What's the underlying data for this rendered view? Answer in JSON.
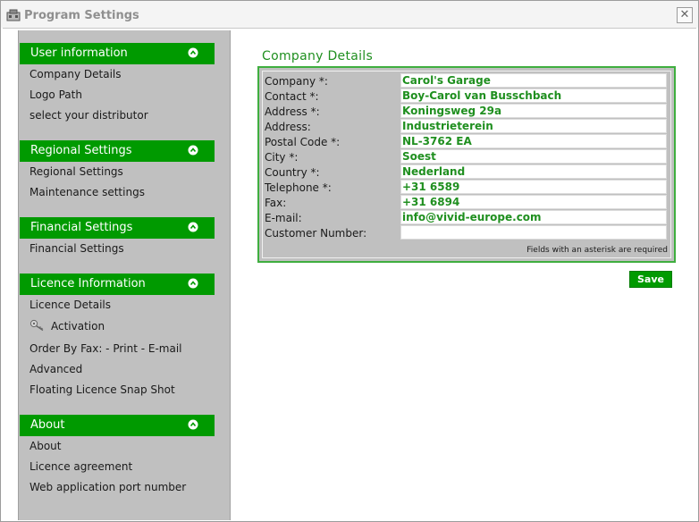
{
  "window": {
    "title": "Program Settings",
    "close_glyph": "✕"
  },
  "sidebar": {
    "sections": [
      {
        "header": "User information",
        "items": [
          "Company Details",
          "Logo Path",
          "select your distributor"
        ]
      },
      {
        "header": "Regional Settings",
        "items": [
          "Regional Settings",
          "Maintenance settings"
        ]
      },
      {
        "header": "Financial Settings",
        "items": [
          "Financial Settings"
        ]
      },
      {
        "header": "Licence Information",
        "items": [
          "Licence Details",
          "Activation",
          "Order By Fax: - Print - E-mail",
          "Advanced",
          "Floating Licence Snap Shot"
        ]
      },
      {
        "header": "About",
        "items": [
          "About",
          "Licence agreement",
          "Web application port number"
        ]
      }
    ]
  },
  "content": {
    "title": "Company Details",
    "fields": [
      {
        "label": "Company *:",
        "value": "Carol's Garage"
      },
      {
        "label": "Contact *:",
        "value": "Boy-Carol van Busschbach"
      },
      {
        "label": "Address *:",
        "value": "Koningsweg 29a"
      },
      {
        "label": "Address:",
        "value": "Industrieterein"
      },
      {
        "label": "Postal Code *:",
        "value": "NL-3762 EA"
      },
      {
        "label": "City *:",
        "value": "Soest"
      },
      {
        "label": "Country *:",
        "value": "Nederland"
      },
      {
        "label": "Telephone *:",
        "value": "+31 6589"
      },
      {
        "label": "Fax:",
        "value": "+31 6894"
      },
      {
        "label": "E-mail:",
        "value": "info@vivid-europe.com"
      },
      {
        "label": "Customer Number:",
        "value": ""
      }
    ],
    "note": "Fields with an asterisk are required",
    "save_label": "Save"
  },
  "colors": {
    "accent_green": "#009a00",
    "text_green": "#1f8f1f",
    "panel_gray": "#c0c0c0"
  },
  "icons": {
    "app": "program-settings-icon",
    "section": "chevron-up-icon",
    "activation": "key-icon"
  }
}
